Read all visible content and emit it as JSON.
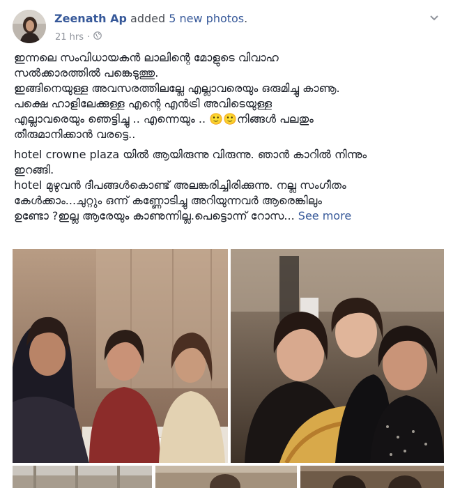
{
  "post": {
    "author_name": "Zeenath Ap",
    "action_text": " added ",
    "photos_link": "5 new photos",
    "period": ".",
    "timestamp": "21 hrs",
    "separator": "·",
    "privacy_icon": "globe-icon",
    "menu_icon": "chevron-down-icon"
  },
  "body": {
    "paragraph1": [
      "ഇന്നലെ സംവിധായകൻ ലാലിന്റെ മോളുടെ വിവാഹ",
      "സൽക്കാരത്തിൽ പങ്കെടുത്തു.",
      "ഇങ്ങിനെയുള്ള അവസരത്തിലല്ലേ എല്ലാവരെയും ഒരുമിച്ചു കാണൂ.",
      "പക്ഷെ ഹാളിലേക്കുള്ള എന്റെ എൻട്രി അവിടെയുള്ള",
      "എല്ലാവരെയും ഞെട്ടിച്ചു .. എന്നെയും .. 🙂🙂നിങ്ങൾ പലതും",
      "തീരുമാനിക്കാൻ വരട്ടെ.."
    ],
    "paragraph2": [
      "hotel crowne plaza യിൽ ആയിരുന്നു വിരുന്നു. ഞാൻ കാറിൽ നിന്നും",
      "ഇറങ്ങി.",
      "hotel മുഴുവൻ ദീപങ്ങൾകൊണ്ട് അലങ്കരിച്ചിരിക്കുന്നു. നല്ല സംഗീതം",
      "കേൾക്കാം...ചുറ്റും ഒന്ന് കണ്ണോടിച്ചു അറിയുന്നവർ ആരെങ്കിലും",
      "ഉണ്ടോ ?ഇല്ല ആരേയും കാണുന്നില്ല.പെട്ടൊന്ന് റോസ..."
    ],
    "see_more": "See more"
  },
  "colors": {
    "link": "#365899",
    "meta": "#90949c",
    "text": "#1d2129"
  }
}
